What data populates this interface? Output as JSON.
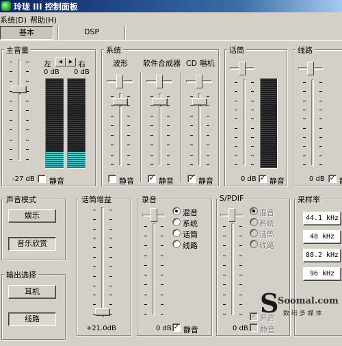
{
  "window": {
    "title": "玲珑 III 控制面板"
  },
  "menu": {
    "system": "系统(D)",
    "help": "帮助(H)"
  },
  "tabs": [
    {
      "label": "基本"
    },
    {
      "label": "DSP"
    }
  ],
  "master": {
    "label": "主音量",
    "left": "左",
    "right": "右",
    "left_db": "0 dB",
    "right_db": "0 dB",
    "volume_db": "-27 dB",
    "mute_label": "静音",
    "mute": false,
    "meter_left_level": 0.18,
    "meter_right_level": 0.18
  },
  "system_group": {
    "label": "系统",
    "channels": [
      {
        "label": "波形",
        "mute_label": "静音",
        "mute": false
      },
      {
        "label": "软件合成器",
        "mute_label": "静音",
        "mute": true
      },
      {
        "label": "CD 唱机",
        "mute_label": "静音",
        "mute": true
      }
    ]
  },
  "mic": {
    "label": "话筒",
    "db": "0 dB",
    "mute_label": "静音",
    "mute": true
  },
  "line": {
    "label": "线路",
    "db": "0 dB",
    "mute_label": "静音",
    "mute": true
  },
  "sound_mode": {
    "label": "声音模式",
    "buttons": [
      "娱乐",
      "音乐欣赏"
    ],
    "selected": "音乐欣赏"
  },
  "output": {
    "label": "输出选择",
    "buttons": [
      "耳机",
      "线路"
    ],
    "selected": "线路"
  },
  "mic_gain": {
    "label": "话筒增益",
    "value": "+21.0dB"
  },
  "record": {
    "label": "录音",
    "options": [
      "混音",
      "系统",
      "话筒",
      "线路"
    ],
    "selected": "混音",
    "db": "0 dB",
    "mute_label": "静音",
    "mute": true
  },
  "spdif": {
    "label": "S/PDIF",
    "options": [
      "混音",
      "系统",
      "话筒",
      "线路"
    ],
    "selected": "混音",
    "on_label": "开启",
    "on": true,
    "db": "0 dB",
    "mute_label": "静音",
    "mute": false
  },
  "sample_rate": {
    "label": "采样率",
    "options": [
      "44.1 kHz",
      "48 kHz",
      "88.2 kHz",
      "96 kHz"
    ]
  },
  "watermark": {
    "brand": "Soomal.com",
    "sub": "数 码 多 媒 体"
  },
  "colors": {
    "meter_lit": "#40e0e0",
    "title_bar": "#0a246a",
    "face": "#d4d0c8"
  }
}
